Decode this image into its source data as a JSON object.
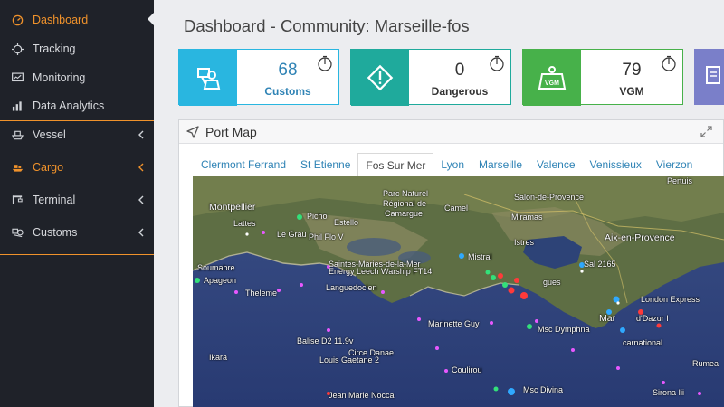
{
  "sidebar": {
    "items": [
      {
        "label": "Dashboard",
        "icon": "speedometer-icon"
      },
      {
        "label": "Tracking",
        "icon": "crosshair-icon"
      },
      {
        "label": "Monitoring",
        "icon": "monitor-chart-icon"
      },
      {
        "label": "Data Analytics",
        "icon": "bar-chart-icon"
      },
      {
        "label": "Vessel",
        "icon": "ship-icon"
      },
      {
        "label": "Cargo",
        "icon": "cargo-icon"
      },
      {
        "label": "Terminal",
        "icon": "terminal-crane-icon"
      },
      {
        "label": "Customs",
        "icon": "customs-icon"
      }
    ],
    "accent_color": "#f0922b"
  },
  "header": {
    "title": "Dashboard - Community: Marseille-fos"
  },
  "cards": [
    {
      "value": "68",
      "label": "Customs",
      "color": "#29b6e0",
      "icon": "customs-officer-icon"
    },
    {
      "value": "0",
      "label": "Dangerous",
      "color": "#1faa9c",
      "icon": "warning-icon"
    },
    {
      "value": "79",
      "label": "VGM",
      "color": "#47b14a",
      "icon": "vgm-weight-icon"
    }
  ],
  "port_map": {
    "title": "Port Map",
    "tabs": [
      "Clermont Ferrand",
      "St Etienne",
      "Fos Sur Mer",
      "Lyon",
      "Marseille",
      "Valence",
      "Venissieux",
      "Vierzon"
    ],
    "active_tab": "Fos Sur Mer",
    "map_labels": {
      "montpellier": "Montpellier",
      "lattes": "Lattes",
      "le_grau": "Le Grau",
      "picho": "Picho",
      "estello": "Estello",
      "phil_flo_v": "Phil Flo V",
      "parc": "Parc Naturel",
      "regional": "Régional de",
      "camargue": "Camargue",
      "camel": "Camel",
      "salon": "Salon-de-Provence",
      "miramas": "Miramas",
      "pertuis": "Pertuis",
      "istres": "Istres",
      "aix": "Aix-en-Provence",
      "soumabre": "Soumabre",
      "apageon": "Apageon",
      "saintes": "Saintes-Maries-de-la-Mer",
      "energy": "Energy Leech Warship FT14",
      "mistral": "Mistral",
      "gues": "gues",
      "sal": "Sal 2165",
      "theleme": "Theleme",
      "languedocien": "Languedocien",
      "london": "London Express",
      "marinette": "Marinette Guy",
      "msc_dymphna": "Msc Dymphna",
      "mar": "Mar",
      "dazur": "d'Dazur I",
      "balise": "Balise D2 11.9v",
      "circe": "Circe Danae",
      "carnational": "carnational",
      "ikara": "Ikara",
      "louis": "Louis Gaetane 2",
      "coulirou": "Coulirou",
      "rumea": "Rumea",
      "jean": "Jean Marie Nocca",
      "msc_divina": "Msc Divina",
      "sirona": "Sirona Iii"
    }
  }
}
